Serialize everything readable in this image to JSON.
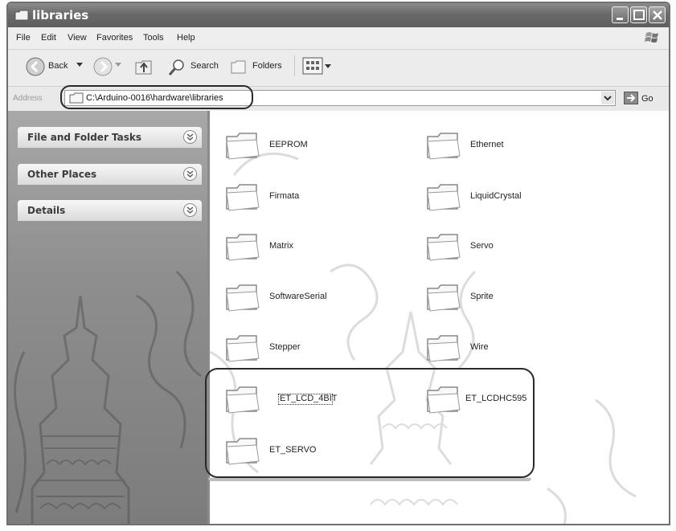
{
  "window": {
    "title": "libraries"
  },
  "menu": [
    "File",
    "Edit",
    "View",
    "Favorites",
    "Tools",
    "Help"
  ],
  "toolbar": {
    "back": "Back",
    "search": "Search",
    "folders": "Folders"
  },
  "address": {
    "label": "Address",
    "path": "C:\\Arduino-0016\\hardware\\libraries",
    "go": "Go"
  },
  "tasks": {
    "panels": [
      "File and Folder Tasks",
      "Other Places",
      "Details"
    ]
  },
  "folders": [
    "EEPROM",
    "Ethernet",
    "Firmata",
    "LiquidCrystal",
    "Matrix",
    "Servo",
    "SoftwareSerial",
    "Sprite",
    "Stepper",
    "Wire",
    "ET_LCD_4BIT",
    "ET_LCDHC595",
    "ET_SERVO"
  ],
  "icons": [
    "folder-icon",
    "back-arrow-icon",
    "forward-arrow-icon",
    "up-folder-icon",
    "search-icon",
    "folders-icon",
    "views-icon",
    "go-icon",
    "chevron-down-icon",
    "minimize-icon",
    "maximize-icon",
    "close-icon",
    "windows-logo-icon"
  ]
}
